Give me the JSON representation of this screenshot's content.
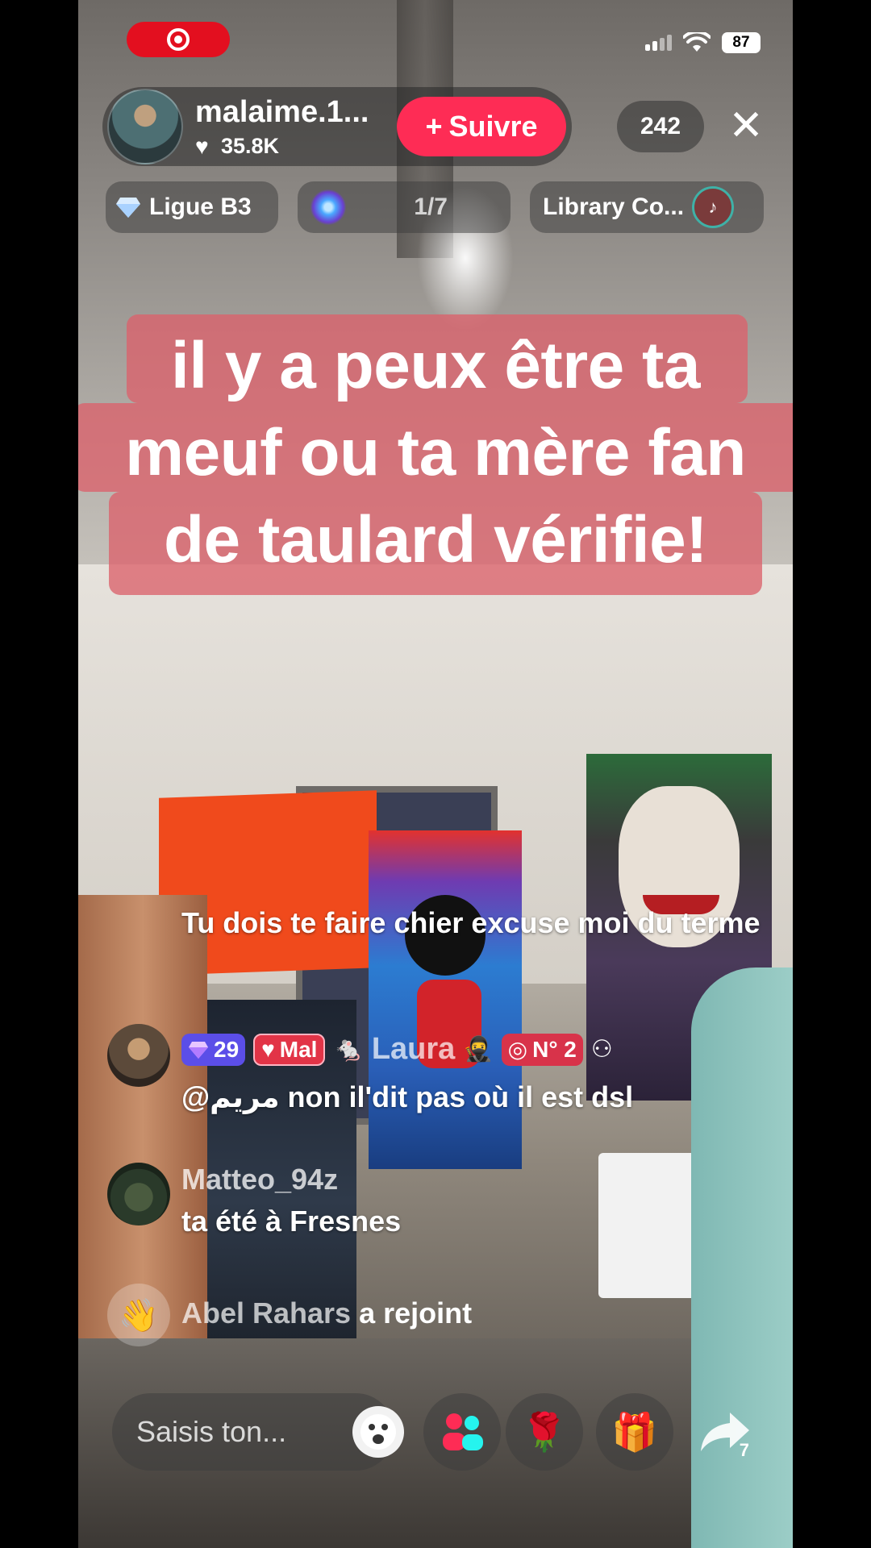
{
  "status_bar": {
    "battery": "87"
  },
  "host": {
    "username": "malaime.1...",
    "likes": "35.8K",
    "follow_label": "Suivre",
    "viewer_count": "242"
  },
  "chips": {
    "league": "Ligue B3",
    "rank": "1/7",
    "library": "Library Co..."
  },
  "banner": {
    "lines": [
      "il y a peux être ta",
      "meuf ou ta mère fan",
      "de taulard vérifie!"
    ]
  },
  "chat": {
    "plain_message": "Tu dois te faire chier excuse moi du terme",
    "message1": {
      "level": "29",
      "fan_badge": "Mal",
      "username": "Laura",
      "rank_badge": "N° 2",
      "text": "@مريم non il'dit pas où il est dsl"
    },
    "message2": {
      "username": "Matteo_94z",
      "text": "ta été à Fresnes"
    },
    "join": {
      "username": "Abel Rahars",
      "action": "a rejoint"
    }
  },
  "bottom_bar": {
    "input_placeholder": "Saisis ton...",
    "share_count": "7"
  },
  "colors": {
    "follow": "#fe2c55",
    "banner": "#db626b",
    "record": "#e30f1f"
  }
}
